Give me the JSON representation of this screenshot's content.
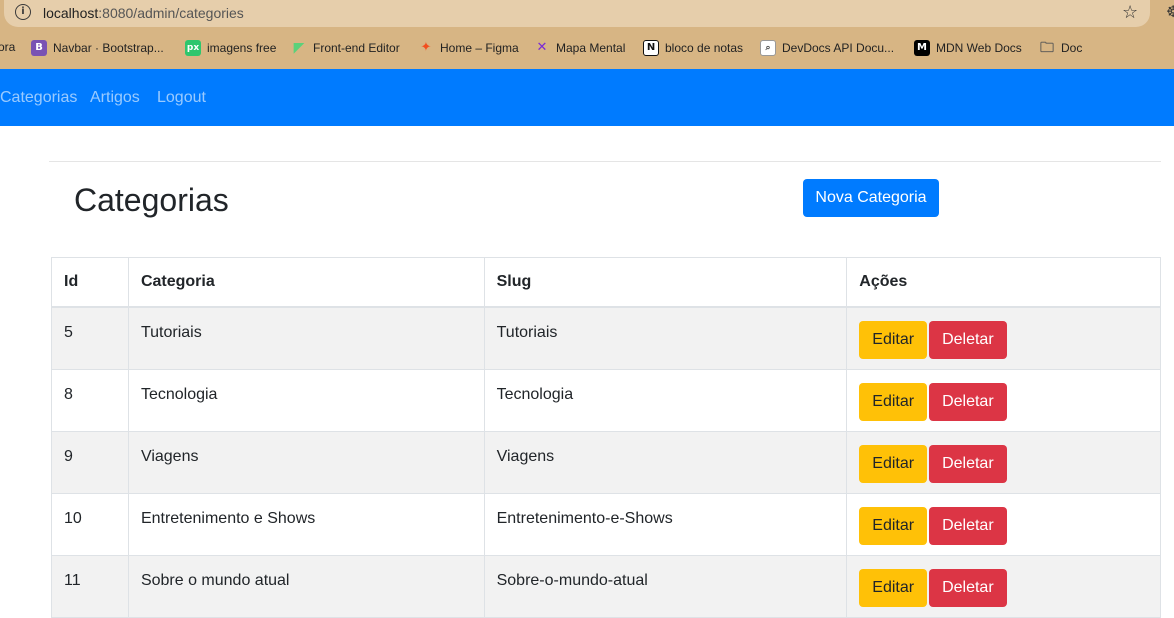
{
  "browser": {
    "url_host": "localhost",
    "url_path": ":8080/admin/categories",
    "bookmarks": [
      {
        "label": "ora",
        "icon": "truncated-bookmark"
      },
      {
        "label": "Navbar · Bootstrap...",
        "icon": "bootstrap-icon",
        "color": "#7952b3",
        "glyph": "B"
      },
      {
        "label": "imagens free",
        "icon": "pixabay-icon",
        "color": "#2ec66d",
        "glyph": "px"
      },
      {
        "label": "Front-end Editor",
        "icon": "flag-icon",
        "color": "#5bd17a",
        "glyph": "◤"
      },
      {
        "label": "Home – Figma",
        "icon": "figma-icon",
        "color": "#f24e1e",
        "glyph": "✦"
      },
      {
        "label": "Mapa Mental",
        "icon": "mindmap-icon",
        "color": "#7a2ad6",
        "glyph": "✕"
      },
      {
        "label": "bloco de notas",
        "icon": "notion-icon",
        "color": "#111111",
        "glyph": "N"
      },
      {
        "label": "DevDocs API Docu...",
        "icon": "devdocs-icon",
        "color": "#ffffff",
        "glyph": "🔍"
      },
      {
        "label": "MDN Web Docs",
        "icon": "mdn-icon",
        "color": "#000000",
        "glyph": "M"
      },
      {
        "label": "Doc",
        "icon": "folder-icon",
        "color": "#555555",
        "glyph": "🗀"
      }
    ]
  },
  "nav": {
    "links": [
      "Categorias",
      "Artigos",
      "Logout"
    ]
  },
  "page": {
    "title": "Categorias",
    "new_button": "Nova Categoria"
  },
  "table": {
    "headers": [
      "Id",
      "Categoria",
      "Slug",
      "Ações"
    ],
    "edit_label": "Editar",
    "delete_label": "Deletar",
    "rows": [
      {
        "id": "5",
        "categoria": "Tutoriais",
        "slug": "Tutoriais"
      },
      {
        "id": "8",
        "categoria": "Tecnologia",
        "slug": "Tecnologia"
      },
      {
        "id": "9",
        "categoria": "Viagens",
        "slug": "Viagens"
      },
      {
        "id": "10",
        "categoria": "Entretenimento e Shows",
        "slug": "Entretenimento-e-Shows"
      },
      {
        "id": "11",
        "categoria": "Sobre o mundo atual",
        "slug": "Sobre-o-mundo-atual"
      }
    ]
  },
  "colors": {
    "primary": "#007bff",
    "warning": "#ffc107",
    "danger": "#dc3545",
    "chrome": "#d7b584"
  }
}
